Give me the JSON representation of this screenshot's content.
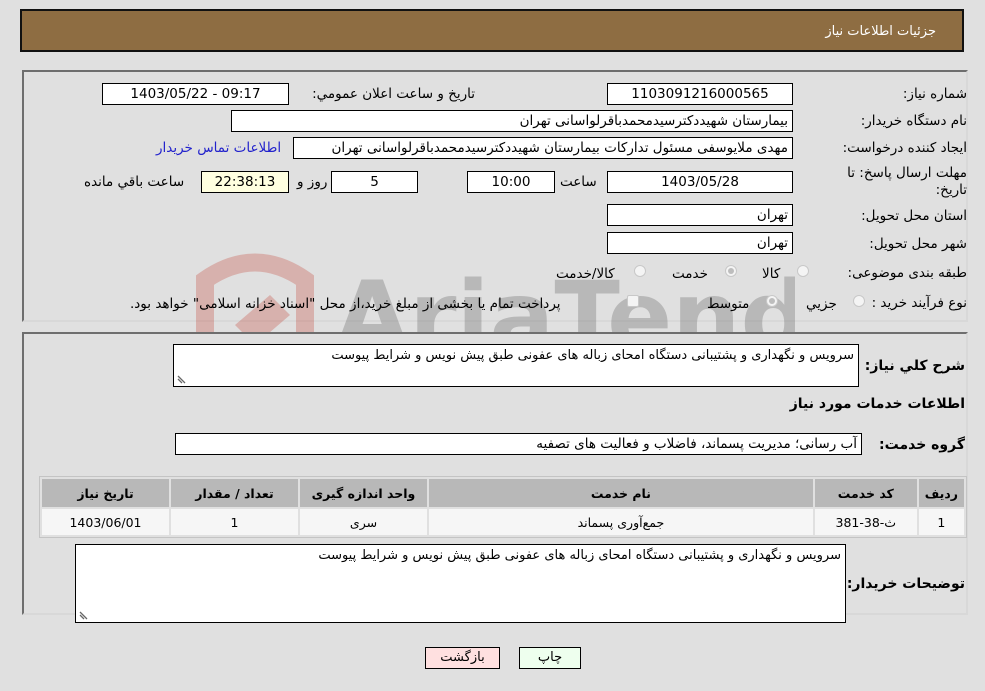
{
  "header": {
    "title": "جزئیات اطلاعات نیاز"
  },
  "form": {
    "need_number_label": "شماره نیاز:",
    "need_number": "1103091216000565",
    "announce_label": "تاریخ و ساعت اعلان عمومي:",
    "announce_value": "1403/05/22 - 09:17",
    "buyer_org_label": "نام دستگاه خریدار:",
    "buyer_org": "بیمارستان شهیددکترسیدمحمدباقرلواسانی تهران",
    "creator_label": "ایجاد کننده درخواست:",
    "creator": "مهدی ملایوسفی مسئول تدارکات بیمارستان شهیددکترسیدمحمدباقرلواسانی تهران",
    "contact_link": "اطلاعات تماس خریدار",
    "deadline_label_line1": "مهلت ارسال پاسخ: تا",
    "deadline_label_line2": "تاریخ:",
    "deadline_date": "1403/05/28",
    "time_label": "ساعت",
    "deadline_time": "10:00",
    "days_value": "5",
    "days_label": "روز و",
    "remaining_time": "22:38:13",
    "remaining_label": "ساعت باقي مانده",
    "province_label": "استان محل تحویل:",
    "province": "تهران",
    "city_label": "شهر محل تحویل:",
    "city": "تهران",
    "category_label": "طبقه بندی موضوعی:",
    "category_options": [
      {
        "label": "کالا",
        "selected": false
      },
      {
        "label": "خدمت",
        "selected": true
      },
      {
        "label": "کالا/خدمت",
        "selected": false
      }
    ],
    "process_label": "نوع فرآیند خرید :",
    "process_options": [
      {
        "label": "جزيي",
        "selected": false
      },
      {
        "label": "متوسط",
        "selected": true
      }
    ],
    "treasury_checkbox_label": "پرداخت تمام یا بخشی از مبلغ خرید،از محل \"اسناد خزانه اسلامی\" خواهد بود.",
    "treasury_checked": false
  },
  "details": {
    "description_label": "شرح کلي نیاز:",
    "description": "سرویس و نگهداری و پشتیبانی دستگاه امحای زباله های عفونی طبق پیش نویس و شرایط پیوست",
    "services_title": "اطلاعات خدمات مورد نیاز",
    "service_group_label": "گروه خدمت:",
    "service_group": "آب رسانی؛ مدیریت پسماند، فاضلاب و فعالیت های تصفیه",
    "table": {
      "headers": [
        "ردیف",
        "کد خدمت",
        "نام خدمت",
        "واحد اندازه گیری",
        "تعداد / مقدار",
        "تاریخ نیاز"
      ],
      "rows": [
        [
          "1",
          "ث-38-381",
          "جمع‌آوری پسماند",
          "سری",
          "1",
          "1403/06/01"
        ]
      ]
    },
    "buyer_notes_label": "توضیحات خریدار:",
    "buyer_notes": "سرویس و نگهداری و پشتیبانی دستگاه امحای زباله های عفونی طبق پیش نویس و شرایط پیوست"
  },
  "buttons": {
    "print": "چاپ",
    "back": "بازگشت",
    "print_bg": "#eeffee",
    "back_bg": "#ffe0e0"
  },
  "watermark": {
    "text": "AriaTender.net"
  }
}
